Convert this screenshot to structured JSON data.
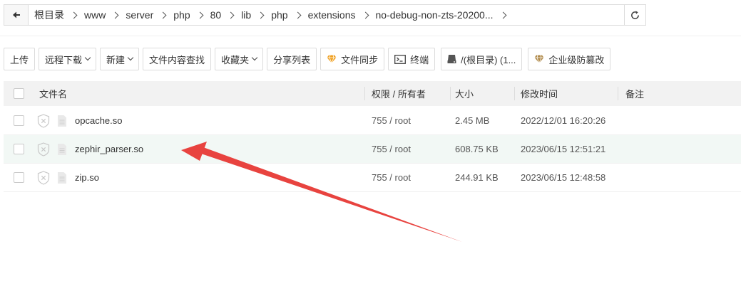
{
  "path": {
    "crumbs": [
      "根目录",
      "www",
      "server",
      "php",
      "80",
      "lib",
      "php",
      "extensions",
      "no-debug-non-zts-20200..."
    ]
  },
  "toolbar": {
    "upload": "上传",
    "remote_download": "远程下载",
    "new": "新建",
    "search_content": "文件内容查找",
    "favorites": "收藏夹",
    "share_list": "分享列表",
    "file_sync": "文件同步",
    "terminal": "终端",
    "disk": "/(根目录) (1...",
    "enterprise": "企业级防篡改"
  },
  "table": {
    "headers": {
      "name": "文件名",
      "perm": "权限 / 所有者",
      "size": "大小",
      "mtime": "修改时间",
      "note": "备注"
    },
    "rows": [
      {
        "name": "opcache.so",
        "perm": "755 / root",
        "size": "2.45 MB",
        "mtime": "2022/12/01 16:20:26",
        "note": ""
      },
      {
        "name": "zephir_parser.so",
        "perm": "755 / root",
        "size": "608.75 KB",
        "mtime": "2023/06/15 12:51:21",
        "note": ""
      },
      {
        "name": "zip.so",
        "perm": "755 / root",
        "size": "244.91 KB",
        "mtime": "2023/06/15 12:48:58",
        "note": ""
      }
    ]
  },
  "colors": {
    "annotation_arrow": "#e8433f",
    "highlight_row": "#f2f8f5",
    "header_bg": "#f2f2f2",
    "vip_icon": "#f0a020"
  },
  "icons": {
    "back": "arrow-left-icon",
    "refresh": "refresh-icon",
    "file": "file-icon",
    "shield": "shield-x-icon",
    "diamond": "diamond-icon",
    "terminal": "terminal-icon",
    "disk": "disk-icon"
  }
}
